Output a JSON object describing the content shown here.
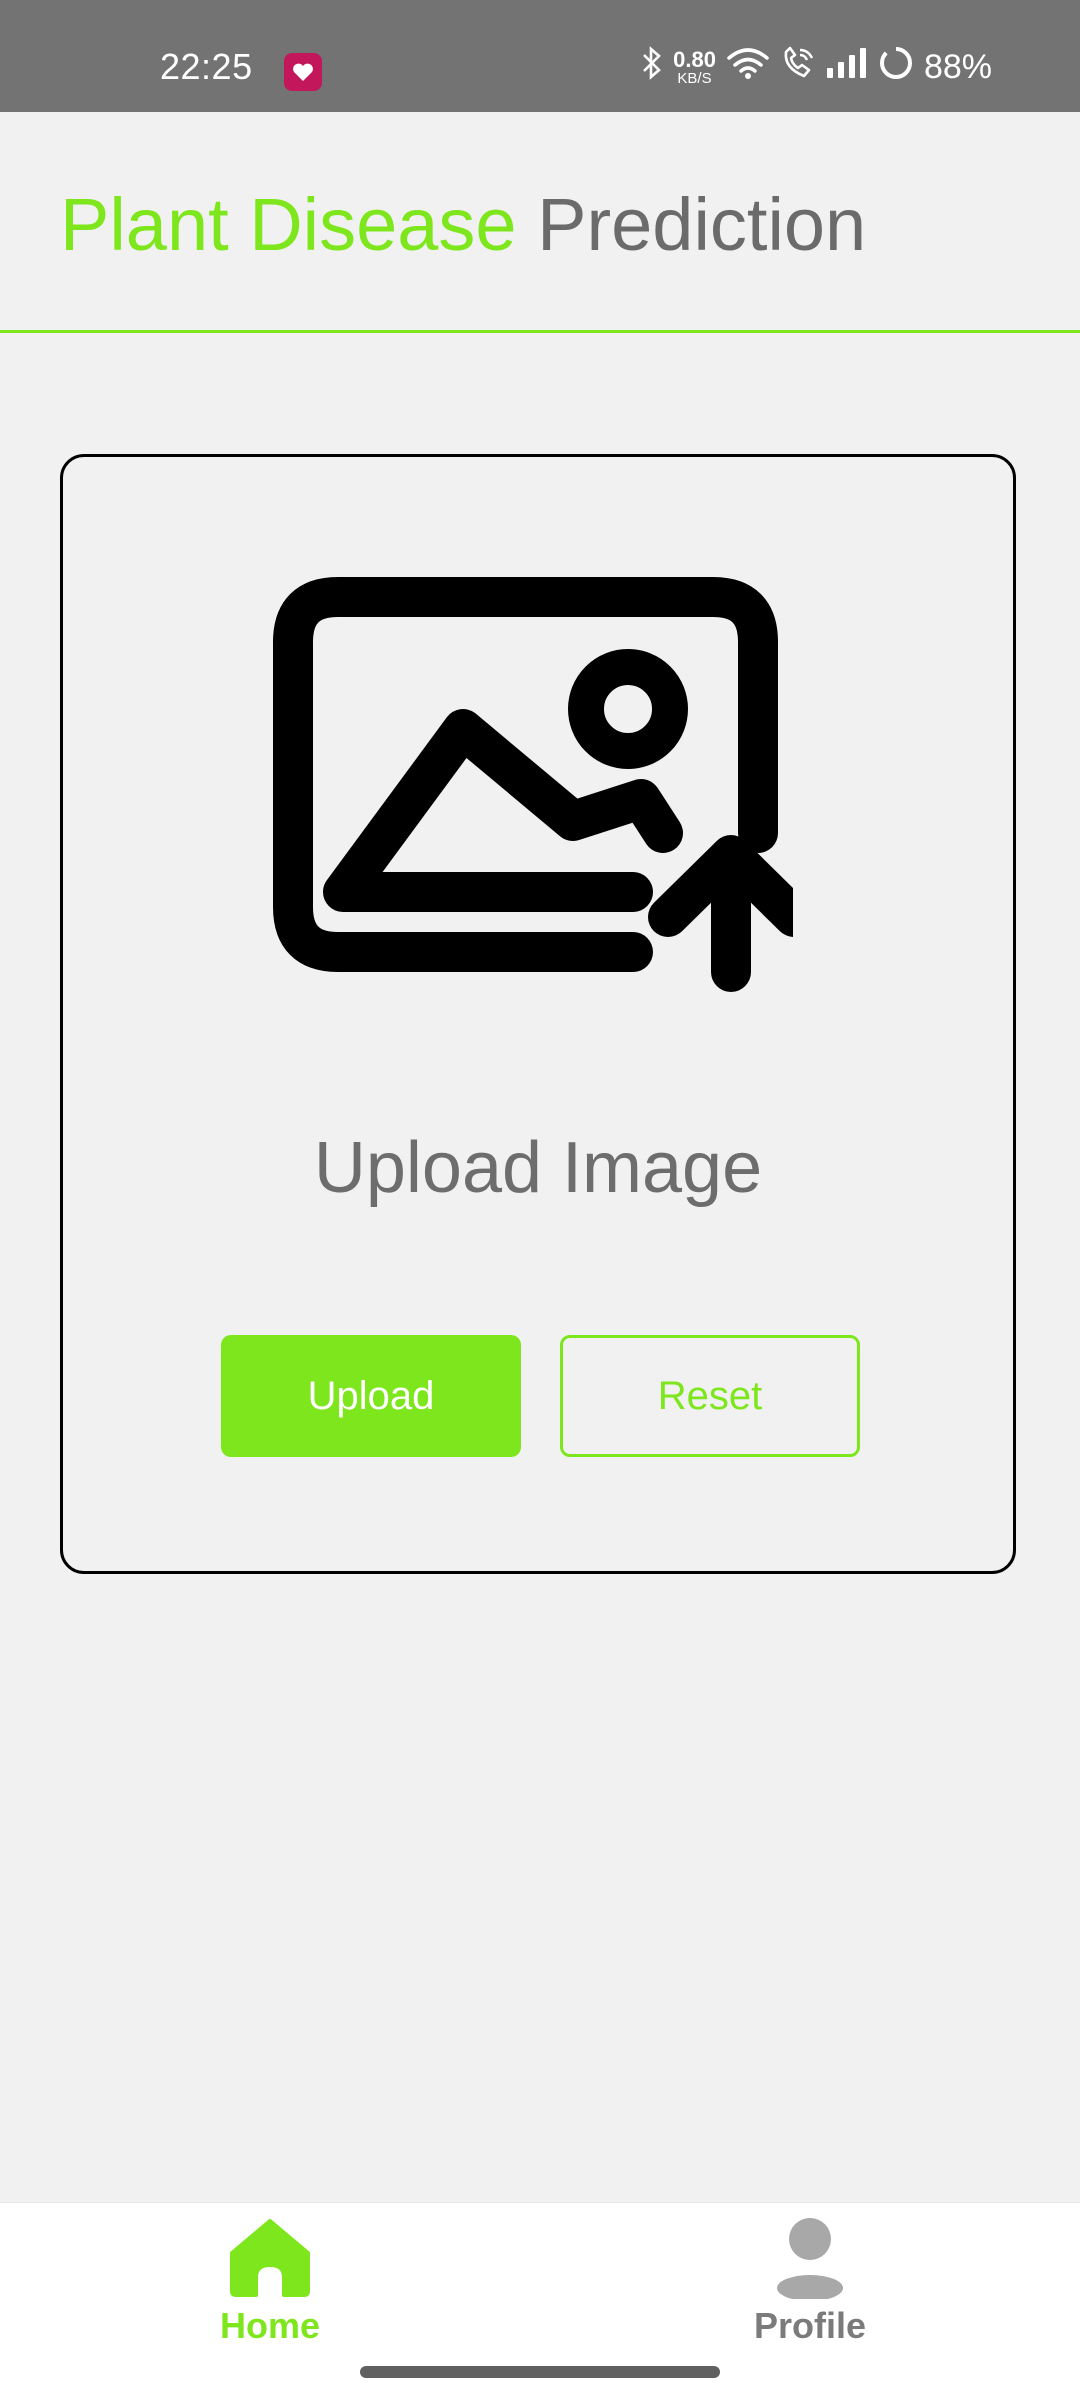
{
  "status_bar": {
    "time": "22:25",
    "network_speed_value": "0.80",
    "network_speed_unit": "KB/S",
    "battery": "88%",
    "icons": [
      "bluetooth-icon",
      "wifi-icon",
      "wifi-call-icon",
      "signal-icon",
      "battery-ring-icon"
    ]
  },
  "header": {
    "title_part1": "Plant Disease",
    "title_part2": "Prediction"
  },
  "upload_card": {
    "icon": "image-upload-icon",
    "label": "Upload Image",
    "upload_button": "Upload",
    "reset_button": "Reset"
  },
  "bottom_nav": {
    "items": [
      {
        "label": "Home",
        "icon": "home-icon",
        "active": true
      },
      {
        "label": "Profile",
        "icon": "profile-icon",
        "active": false
      }
    ]
  },
  "colors": {
    "accent": "#7ee61c",
    "status_bar": "#737373",
    "background": "#f1f1f1",
    "text_grey": "#6b6b6b"
  }
}
